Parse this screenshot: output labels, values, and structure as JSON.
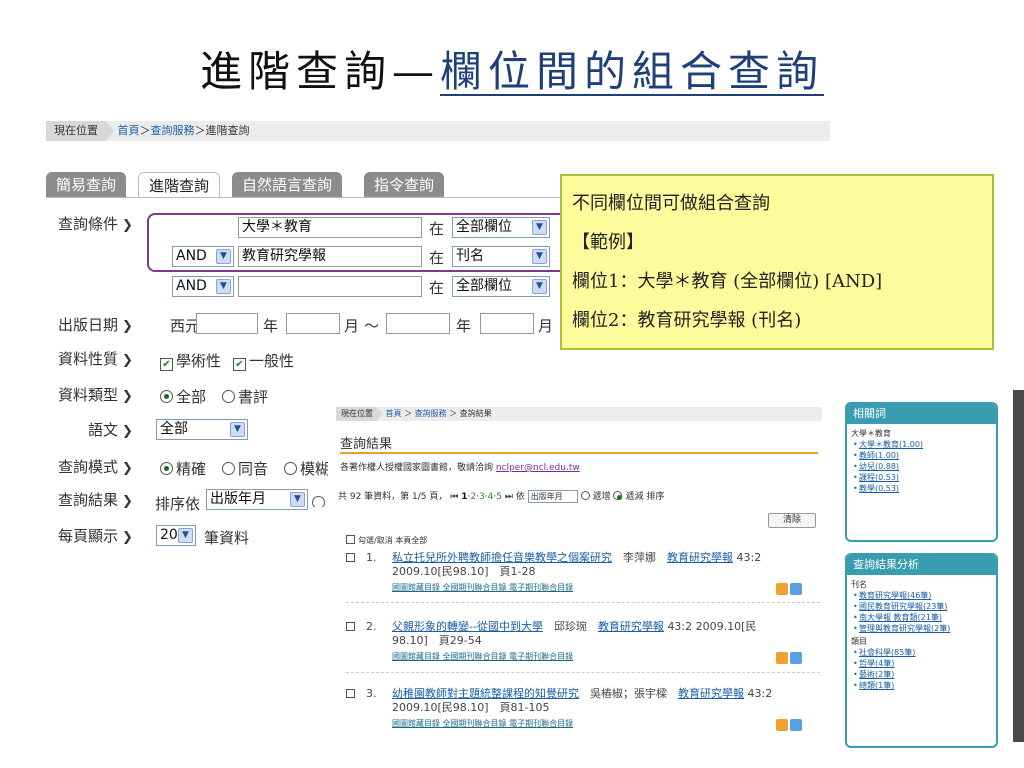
{
  "slide": {
    "title_plain": "進階查詢—",
    "title_underlined": "欄位間的組合查詢"
  },
  "breadcrumb": {
    "label": "現在位置",
    "home": "首頁",
    "sep1": "＞",
    "service": "查詢服務",
    "sep2": "＞",
    "current": "進階查詢"
  },
  "tabs": [
    "簡易查詢",
    "進階查詢",
    "自然語言查詢",
    "指令查詢"
  ],
  "form": {
    "labels": {
      "condition": "查詢條件",
      "pubdate": "出版日期",
      "nature": "資料性質",
      "type": "資料類型",
      "lang": "語文",
      "mode": "查詢模式",
      "result": "查詢結果",
      "perpage": "每頁顯示"
    },
    "rows": [
      {
        "op": "",
        "value": "大學＊教育",
        "in": "在",
        "field": "全部欄位"
      },
      {
        "op": "AND",
        "value": "教育研究學報",
        "in": "在",
        "field": "刊名"
      },
      {
        "op": "AND",
        "value": "",
        "in": "在",
        "field": "全部欄位"
      }
    ],
    "date": {
      "era": "西元",
      "year": "年",
      "month": "月",
      "tilde": "～",
      "year2": "年",
      "month2": "月"
    },
    "nature": {
      "academic": "學術性",
      "general": "一般性"
    },
    "type": {
      "all": "全部",
      "review": "書評"
    },
    "lang_value": "全部",
    "mode": {
      "exact": "精確",
      "homophone": "同音",
      "fuzzy": "模糊"
    },
    "sort_label": "排序依",
    "sort_value": "出版年月",
    "perpage_value": "20",
    "perpage_unit": "筆資料"
  },
  "note": {
    "line1": "不同欄位間可做組合查詢",
    "line2": "【範例】",
    "line3": "欄位1：大學＊教育 (全部欄位) [AND]",
    "line4": "欄位2：教育研究學報 (刊名)"
  },
  "results": {
    "crumb_label": "現在位置",
    "crumb_home": "首頁",
    "crumb_service": "查詢服務",
    "crumb_current": "查詢結果",
    "title": "查詢結果",
    "notice_text": "各著作權人授權國家圖書館，敬請洽詢",
    "notice_email": "nclper@ncl.edu.tw",
    "pager_text": "共 92 筆資料，第 1/5 頁，",
    "pages": [
      "1",
      "2",
      "3",
      "4",
      "5"
    ],
    "sort_by": "依",
    "sort_select": "出版年月",
    "asc": "遞增",
    "desc": "遞減",
    "sort_word": "排序",
    "clear": "清除",
    "select_all": "勾選/取消 本頁全部",
    "items": [
      {
        "no": "1.",
        "title": "私立托兒所外聘教師擔任音樂教學之個案研究",
        "author": "李萍娜",
        "journal": "教育研究學報",
        "meta1": "43:2",
        "meta2": "2009.10[民98.10]　頁1-28",
        "links": "國圖館藏目錄 全國期刊聯合目錄 電子期刊聯合目錄"
      },
      {
        "no": "2.",
        "title": "父親形象的轉變--從國中到大學",
        "author": "邱珍琬",
        "journal": "教育研究學報",
        "meta1": "43:2 2009.10[民",
        "meta2": "98.10]　頁29-54",
        "links": "國圖館藏目錄 全國期刊聯合目錄 電子期刊聯合目錄"
      },
      {
        "no": "3.",
        "title": "幼稚園教師對主題統整課程的知覺研究",
        "author": "吳樁椒；張宇樑",
        "journal": "教育研究學報",
        "meta1": "43:2",
        "meta2": "2009.10[民98.10]　頁81-105",
        "links": "國圖館藏目錄 全國期刊聯合目錄 電子期刊聯合目錄"
      }
    ]
  },
  "related": {
    "title": "相關詞",
    "query": "大學＊教育",
    "items": [
      "大學＊教育(1.00)",
      "教師(1.00)",
      "幼兒(0.88)",
      "課程(0.53)",
      "教學(0.53)"
    ]
  },
  "analysis": {
    "title": "查詢結果分析",
    "group1": "刊名",
    "items1": [
      "教育研究學報(46筆)",
      "國民教育研究學報(23筆)",
      "南大學報 教育類(21筆)",
      "管理與教育研究學報(2筆)"
    ],
    "group2": "類目",
    "items2": [
      "社會科學(85筆)",
      "哲學(4筆)",
      "藝術(2筆)",
      "總類(1筆)"
    ]
  },
  "colors": {
    "accent_purple": "#7b3b8a",
    "note_bg": "#fcfc9c",
    "panel_teal": "#3a9cb0",
    "link_blue": "#1a5fa6"
  }
}
